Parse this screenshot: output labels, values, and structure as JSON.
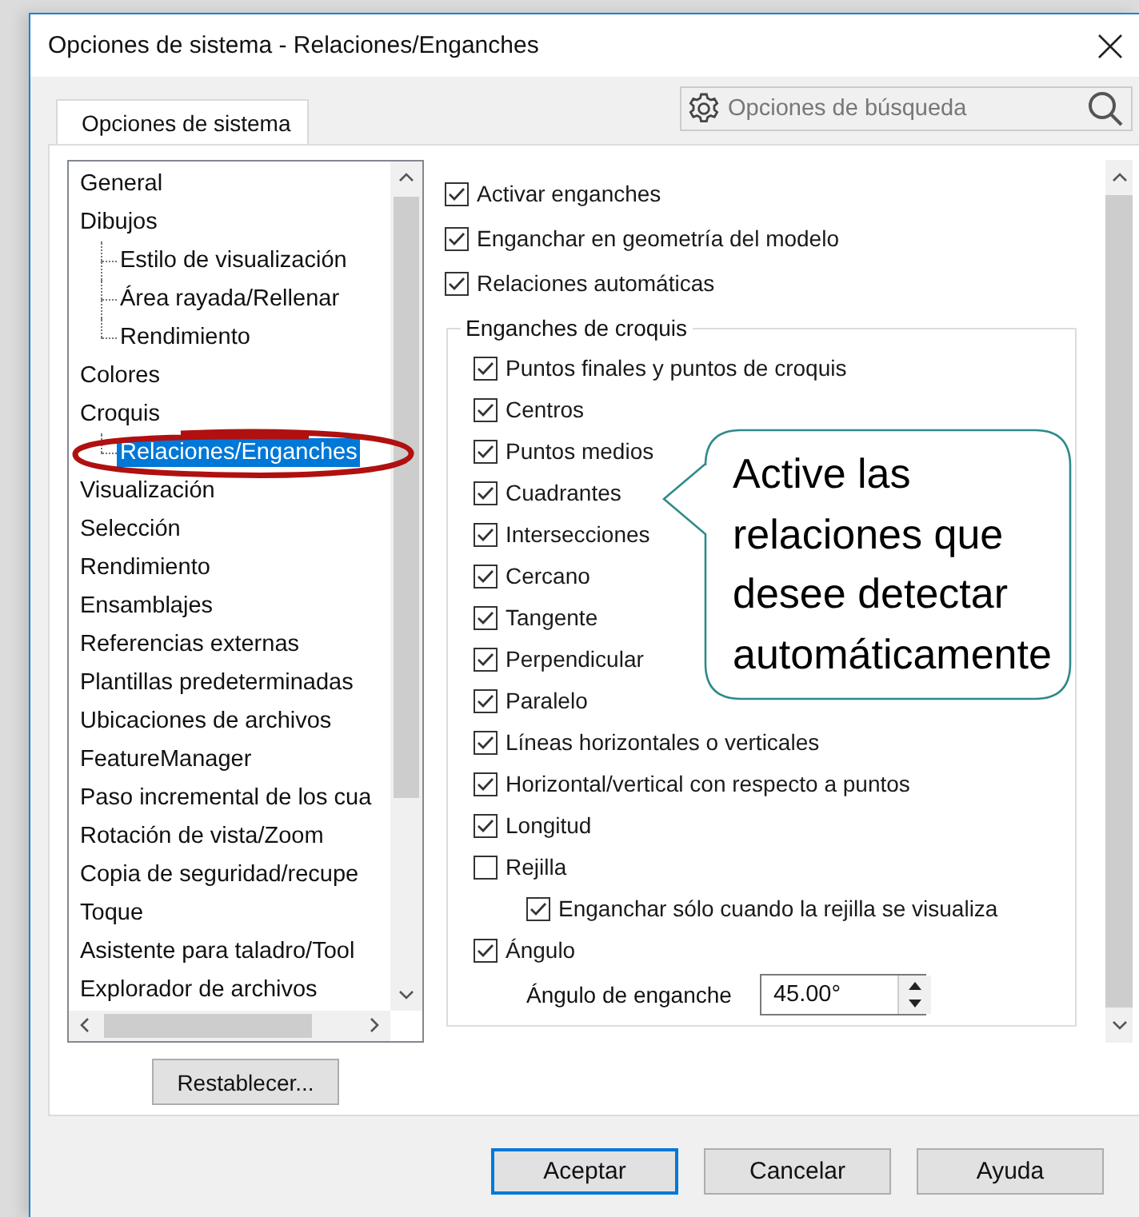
{
  "window": {
    "title": "Opciones de sistema - Relaciones/Enganches"
  },
  "tabs": [
    {
      "label": "Opciones de sistema",
      "selected": true
    }
  ],
  "search": {
    "placeholder": "Opciones de búsqueda"
  },
  "tree": {
    "items": [
      {
        "label": "General",
        "selected": false
      },
      {
        "label": "Dibujos",
        "selected": false,
        "children": [
          {
            "label": "Estilo de visualización",
            "selected": false
          },
          {
            "label": "Área rayada/Rellenar",
            "selected": false
          },
          {
            "label": "Rendimiento",
            "selected": false
          }
        ]
      },
      {
        "label": "Colores",
        "selected": false
      },
      {
        "label": "Croquis",
        "selected": false,
        "children": [
          {
            "label": "Relaciones/Enganches",
            "selected": true
          }
        ]
      },
      {
        "label": "Visualización",
        "selected": false
      },
      {
        "label": "Selección",
        "selected": false
      },
      {
        "label": "Rendimiento",
        "selected": false
      },
      {
        "label": "Ensamblajes",
        "selected": false
      },
      {
        "label": "Referencias externas",
        "selected": false
      },
      {
        "label": "Plantillas predeterminadas",
        "selected": false
      },
      {
        "label": "Ubicaciones de archivos",
        "selected": false
      },
      {
        "label": "FeatureManager",
        "selected": false
      },
      {
        "label": "Paso incremental de los cua",
        "selected": false
      },
      {
        "label": "Rotación de vista/Zoom",
        "selected": false
      },
      {
        "label": "Copia de seguridad/recupe",
        "selected": false
      },
      {
        "label": "Toque",
        "selected": false
      },
      {
        "label": "Asistente para taladro/Tool",
        "selected": false
      },
      {
        "label": "Explorador de archivos",
        "selected": false
      }
    ]
  },
  "reset_button": "Restablecer...",
  "options": [
    {
      "label": "Activar enganches",
      "checked": true
    },
    {
      "label": "Enganchar en geometría del modelo",
      "checked": true
    },
    {
      "label": "Relaciones automáticas",
      "checked": true
    }
  ],
  "group": {
    "title": "Enganches de croquis",
    "items": [
      {
        "kind": "check",
        "label": "Puntos finales y puntos de croquis",
        "checked": true
      },
      {
        "kind": "check",
        "label": "Centros",
        "checked": true
      },
      {
        "kind": "check",
        "label": "Puntos medios",
        "checked": true
      },
      {
        "kind": "check",
        "label": "Cuadrantes",
        "checked": true
      },
      {
        "kind": "check",
        "label": "Intersecciones",
        "checked": true
      },
      {
        "kind": "check",
        "label": "Cercano",
        "checked": true
      },
      {
        "kind": "check",
        "label": "Tangente",
        "checked": true
      },
      {
        "kind": "check",
        "label": "Perpendicular",
        "checked": true
      },
      {
        "kind": "check",
        "label": "Paralelo",
        "checked": true
      },
      {
        "kind": "check",
        "label": "Líneas horizontales o verticales",
        "checked": true
      },
      {
        "kind": "check",
        "label": "Horizontal/vertical con respecto a puntos",
        "checked": true
      },
      {
        "kind": "check",
        "label": "Longitud",
        "checked": true
      },
      {
        "kind": "check",
        "label": "Rejilla",
        "checked": false
      },
      {
        "kind": "subcheck",
        "label": "Enganchar sólo cuando la rejilla se visualiza",
        "checked": true
      },
      {
        "kind": "check",
        "label": "Ángulo",
        "checked": true
      },
      {
        "kind": "spin",
        "label": "Ángulo de enganche",
        "value": "45.00°"
      }
    ]
  },
  "buttons": [
    {
      "label": "Aceptar",
      "default": true
    },
    {
      "label": "Cancelar",
      "default": false
    },
    {
      "label": "Ayuda",
      "default": false
    }
  ],
  "callout": {
    "text": "Active las relaciones que desee detectar automáticamente"
  }
}
